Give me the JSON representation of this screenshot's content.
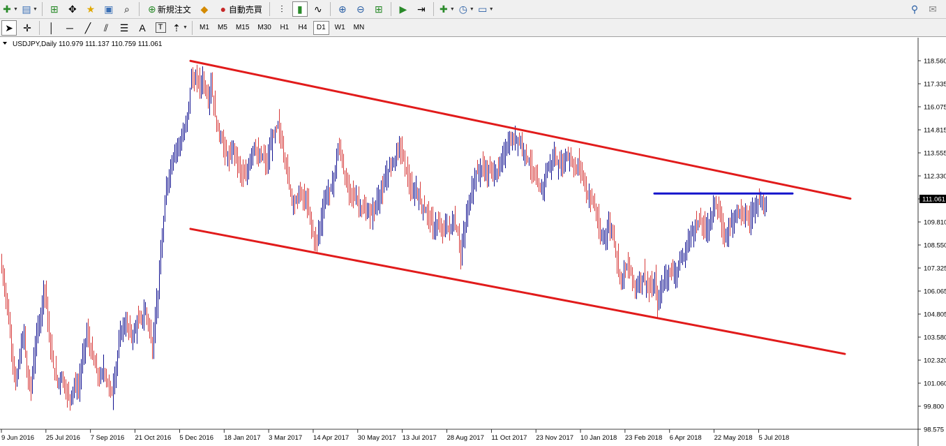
{
  "toolbar1": {
    "new_order_label": "新規注文",
    "autotrade_label": "自動売買",
    "icons": [
      "new-chart-icon",
      "profiles-icon",
      "market-watch-icon",
      "crosshair-move-icon",
      "favorites-icon",
      "navigator-icon",
      "tester-icon",
      "new-order-icon",
      "expert-icon",
      "autotrade-icon",
      "bar-chart-icon",
      "candlestick-icon",
      "line-chart-icon",
      "zoom-in-icon",
      "zoom-out-icon",
      "tile-windows-icon",
      "auto-scroll-icon",
      "chart-shift-icon",
      "indicators-icon",
      "periods-icon",
      "templates-icon",
      "search-icon",
      "chat-icon"
    ]
  },
  "toolbar2": {
    "timeframes": [
      "M1",
      "M5",
      "M15",
      "M30",
      "H1",
      "H4",
      "D1",
      "W1",
      "MN"
    ],
    "active_timeframe": "D1",
    "tool_text_label": "A",
    "tool_label_label": "T"
  },
  "chart_header": {
    "symbol_info": "USDJPY,Daily  110.979 111.137 110.759 111.061"
  },
  "chart_data": {
    "type": "bar",
    "title": "",
    "ylim": [
      98.575,
      118.56
    ],
    "yticks": [
      "118.560",
      "117.335",
      "116.075",
      "114.815",
      "113.555",
      "112.330",
      "111.061",
      "109.810",
      "108.550",
      "107.325",
      "106.065",
      "104.805",
      "103.580",
      "102.320",
      "101.060",
      "99.800",
      "98.575"
    ],
    "current_price": "111.061",
    "xticks": [
      "9 Jun 2016",
      "25 Jul 2016",
      "7 Sep 2016",
      "21 Oct 2016",
      "5 Dec 2016",
      "18 Jan 2017",
      "3 Mar 2017",
      "14 Apr 2017",
      "30 May 2017",
      "13 Jul 2017",
      "28 Aug 2017",
      "11 Oct 2017",
      "23 Nov 2017",
      "10 Jan 2018",
      "23 Feb 2018",
      "6 Apr 2018",
      "22 May 2018",
      "5 Jul 2018"
    ],
    "price_path": [
      [
        0,
        107.6
      ],
      [
        4,
        106.8
      ],
      [
        10,
        105.2
      ],
      [
        16,
        103.0
      ],
      [
        22,
        100.9
      ],
      [
        28,
        102.6
      ],
      [
        34,
        103.9
      ],
      [
        38,
        101.5
      ],
      [
        44,
        100.8
      ],
      [
        48,
        102.4
      ],
      [
        54,
        104.2
      ],
      [
        58,
        104.8
      ],
      [
        62,
        106.3
      ],
      [
        66,
        105.6
      ],
      [
        70,
        103.4
      ],
      [
        76,
        102.0
      ],
      [
        82,
        101.1
      ],
      [
        88,
        101.5
      ],
      [
        94,
        100.6
      ],
      [
        100,
        100.3
      ],
      [
        106,
        101.0
      ],
      [
        112,
        100.8
      ],
      [
        118,
        102.5
      ],
      [
        124,
        103.8
      ],
      [
        130,
        102.8
      ],
      [
        136,
        102.0
      ],
      [
        142,
        101.2
      ],
      [
        148,
        101.9
      ],
      [
        154,
        101.0
      ],
      [
        160,
        100.5
      ],
      [
        166,
        102.0
      ],
      [
        172,
        103.8
      ],
      [
        178,
        104.3
      ],
      [
        184,
        104.0
      ],
      [
        190,
        103.6
      ],
      [
        196,
        104.4
      ],
      [
        202,
        104.5
      ],
      [
        208,
        105.0
      ],
      [
        214,
        104.0
      ],
      [
        218,
        102.8
      ],
      [
        222,
        104.9
      ],
      [
        226,
        106.0
      ],
      [
        230,
        108.1
      ],
      [
        234,
        109.8
      ],
      [
        238,
        111.7
      ],
      [
        242,
        112.4
      ],
      [
        246,
        113.1
      ],
      [
        250,
        113.7
      ],
      [
        254,
        113.9
      ],
      [
        258,
        114.2
      ],
      [
        262,
        114.5
      ],
      [
        266,
        115.0
      ],
      [
        270,
        116.2
      ],
      [
        274,
        117.8
      ],
      [
        278,
        117.3
      ],
      [
        282,
        117.6
      ],
      [
        286,
        117.2
      ],
      [
        290,
        117.6
      ],
      [
        294,
        117.0
      ],
      [
        298,
        116.5
      ],
      [
        302,
        117.3
      ],
      [
        306,
        116.2
      ],
      [
        310,
        115.0
      ],
      [
        316,
        114.5
      ],
      [
        322,
        113.6
      ],
      [
        328,
        113.2
      ],
      [
        334,
        113.9
      ],
      [
        340,
        113.0
      ],
      [
        346,
        112.4
      ],
      [
        352,
        112.2
      ],
      [
        358,
        113.3
      ],
      [
        364,
        114.0
      ],
      [
        370,
        113.2
      ],
      [
        376,
        113.4
      ],
      [
        382,
        112.9
      ],
      [
        388,
        114.1
      ],
      [
        394,
        114.7
      ],
      [
        398,
        115.1
      ],
      [
        404,
        114.0
      ],
      [
        410,
        112.8
      ],
      [
        416,
        111.4
      ],
      [
        422,
        110.8
      ],
      [
        428,
        111.4
      ],
      [
        434,
        111.1
      ],
      [
        440,
        110.8
      ],
      [
        446,
        109.6
      ],
      [
        450,
        108.8
      ],
      [
        454,
        108.9
      ],
      [
        460,
        110.0
      ],
      [
        466,
        111.3
      ],
      [
        472,
        111.4
      ],
      [
        478,
        112.2
      ],
      [
        484,
        113.8
      ],
      [
        488,
        113.6
      ],
      [
        494,
        112.1
      ],
      [
        500,
        111.5
      ],
      [
        506,
        111.3
      ],
      [
        512,
        111.0
      ],
      [
        518,
        110.5
      ],
      [
        524,
        110.4
      ],
      [
        530,
        110.2
      ],
      [
        536,
        110.5
      ],
      [
        542,
        111.2
      ],
      [
        548,
        111.5
      ],
      [
        554,
        112.4
      ],
      [
        560,
        113.0
      ],
      [
        566,
        113.3
      ],
      [
        572,
        114.0
      ],
      [
        578,
        113.2
      ],
      [
        584,
        112.3
      ],
      [
        590,
        111.2
      ],
      [
        596,
        111.6
      ],
      [
        602,
        110.9
      ],
      [
        608,
        110.5
      ],
      [
        614,
        110.2
      ],
      [
        620,
        109.5
      ],
      [
        626,
        109.7
      ],
      [
        632,
        109.3
      ],
      [
        638,
        109.6
      ],
      [
        644,
        109.4
      ],
      [
        650,
        109.9
      ],
      [
        656,
        109.2
      ],
      [
        660,
        108.0
      ],
      [
        664,
        109.1
      ],
      [
        670,
        110.5
      ],
      [
        676,
        111.6
      ],
      [
        680,
        112.3
      ],
      [
        686,
        112.6
      ],
      [
        692,
        112.8
      ],
      [
        698,
        112.4
      ],
      [
        704,
        112.7
      ],
      [
        710,
        112.4
      ],
      [
        716,
        112.8
      ],
      [
        722,
        113.6
      ],
      [
        728,
        114.0
      ],
      [
        734,
        114.2
      ],
      [
        740,
        114.4
      ],
      [
        746,
        114.1
      ],
      [
        752,
        113.6
      ],
      [
        758,
        113.1
      ],
      [
        764,
        112.4
      ],
      [
        770,
        111.8
      ],
      [
        776,
        111.4
      ],
      [
        782,
        112.6
      ],
      [
        788,
        112.9
      ],
      [
        794,
        113.4
      ],
      [
        800,
        112.8
      ],
      [
        806,
        113.0
      ],
      [
        812,
        113.5
      ],
      [
        818,
        113.2
      ],
      [
        824,
        112.6
      ],
      [
        830,
        113.0
      ],
      [
        836,
        112.1
      ],
      [
        842,
        111.2
      ],
      [
        848,
        111.1
      ],
      [
        852,
        110.6
      ],
      [
        856,
        109.8
      ],
      [
        860,
        108.9
      ],
      [
        866,
        109.1
      ],
      [
        872,
        109.6
      ],
      [
        878,
        109.3
      ],
      [
        882,
        108.2
      ],
      [
        886,
        107.3
      ],
      [
        890,
        106.6
      ],
      [
        894,
        107.2
      ],
      [
        898,
        107.4
      ],
      [
        904,
        107.0
      ],
      [
        910,
        106.2
      ],
      [
        916,
        106.6
      ],
      [
        922,
        106.9
      ],
      [
        928,
        106.3
      ],
      [
        934,
        106.1
      ],
      [
        938,
        106.6
      ],
      [
        942,
        105.3
      ],
      [
        946,
        106.0
      ],
      [
        950,
        106.6
      ],
      [
        956,
        107.0
      ],
      [
        962,
        107.2
      ],
      [
        968,
        107.0
      ],
      [
        974,
        107.7
      ],
      [
        980,
        107.9
      ],
      [
        986,
        108.8
      ],
      [
        990,
        109.2
      ],
      [
        996,
        109.6
      ],
      [
        1002,
        109.9
      ],
      [
        1008,
        109.5
      ],
      [
        1014,
        109.6
      ],
      [
        1020,
        110.2
      ],
      [
        1024,
        111.0
      ],
      [
        1028,
        110.5
      ],
      [
        1034,
        109.6
      ],
      [
        1038,
        108.9
      ],
      [
        1042,
        109.4
      ],
      [
        1046,
        109.6
      ],
      [
        1050,
        110.0
      ],
      [
        1056,
        110.5
      ],
      [
        1062,
        110.3
      ],
      [
        1068,
        110.2
      ],
      [
        1074,
        109.9
      ],
      [
        1078,
        110.4
      ],
      [
        1082,
        110.9
      ],
      [
        1088,
        111.0
      ],
      [
        1094,
        110.6
      ],
      [
        1098,
        111.06
      ]
    ],
    "trendlines": [
      {
        "color": "#e11b1b",
        "points": [
          [
            273,
            118.55
          ],
          [
            1219,
            111.08
          ]
        ]
      },
      {
        "color": "#e11b1b",
        "points": [
          [
            273,
            109.44
          ],
          [
            1211,
            102.66
          ]
        ]
      },
      {
        "color": "#1414cc",
        "points": [
          [
            938,
            111.36
          ],
          [
            1136,
            111.36
          ]
        ]
      }
    ],
    "colors": {
      "up": "#0f0f8f",
      "down": "#d63a3a",
      "trendline": "#e11b1b",
      "resistance": "#1414cc",
      "price_box": "#000000"
    }
  }
}
